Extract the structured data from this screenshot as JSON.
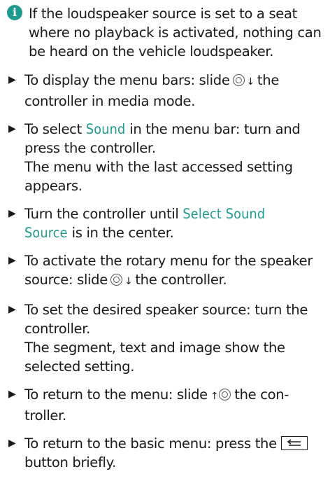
{
  "info": {
    "lines": [
      "If the loudspeaker source is set to a seat",
      "where no playback is activated, nothing can",
      "be heard on the vehicle loudspeaker."
    ]
  },
  "steps": [
    {
      "l1_pre": "To display the menu bars: slide",
      "l1_post": "the",
      "l2": "controller in media mode."
    },
    {
      "l1_pre": "To select",
      "l1_hl": "Sound",
      "l1_post": "in the menu bar: turn and",
      "l2": "press the controller.",
      "l3": "The menu with the last accessed setting",
      "l4": "appears."
    },
    {
      "l1_pre": "Turn the controller until",
      "l1_hl": "Select Sound",
      "l2_hl": "Source",
      "l2_post": "is in the center."
    },
    {
      "l1": "To activate the rotary menu for the speaker",
      "l2_pre": "source: slide",
      "l2_post": "the controller."
    },
    {
      "l1": "To set the desired speaker source: turn the",
      "l2": "controller.",
      "l3": "The segment, text and image show the",
      "l4": "selected setting."
    },
    {
      "l1_pre": "To return to the menu: slide",
      "l1_post": "the con-",
      "l2": "troller."
    },
    {
      "l1_pre": "To return to the basic menu: press the",
      "l2": "button briefly."
    }
  ],
  "icons": {
    "info": "i",
    "bullet": "▶",
    "down": "↓",
    "up": "↑"
  },
  "colors": {
    "accent": "#1e9b8e",
    "text": "#1a1a1a"
  }
}
